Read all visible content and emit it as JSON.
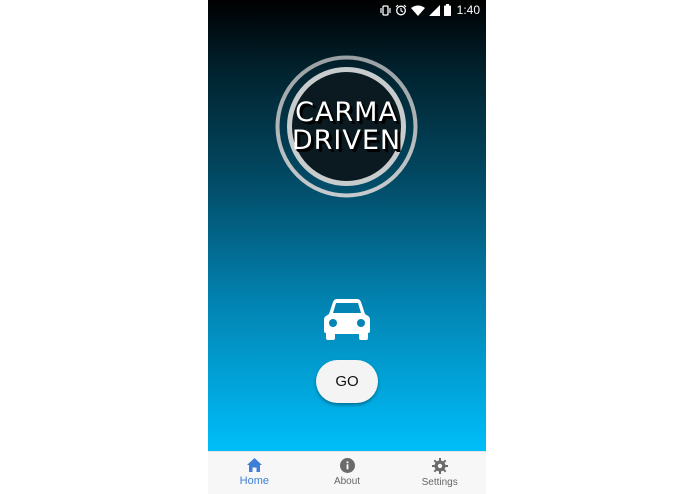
{
  "status_bar": {
    "time": "1:40",
    "icons": [
      "vibrate-icon",
      "alarm-icon",
      "wifi-icon",
      "signal-icon",
      "battery-icon"
    ]
  },
  "logo": {
    "line1": "CARMA",
    "line2": "DRIVEN"
  },
  "main": {
    "car_icon": "car-icon",
    "go_label": "GO"
  },
  "tabs": [
    {
      "label": "Home",
      "icon": "home-icon",
      "active": true
    },
    {
      "label": "About",
      "icon": "info-icon",
      "active": false
    },
    {
      "label": "Settings",
      "icon": "gear-icon",
      "active": false
    }
  ],
  "colors": {
    "gradient_top": "#000000",
    "gradient_bottom": "#00befa",
    "tab_active": "#3d7fd6",
    "tab_inactive": "#666666",
    "tab_bar_bg": "#f7f7f7"
  }
}
